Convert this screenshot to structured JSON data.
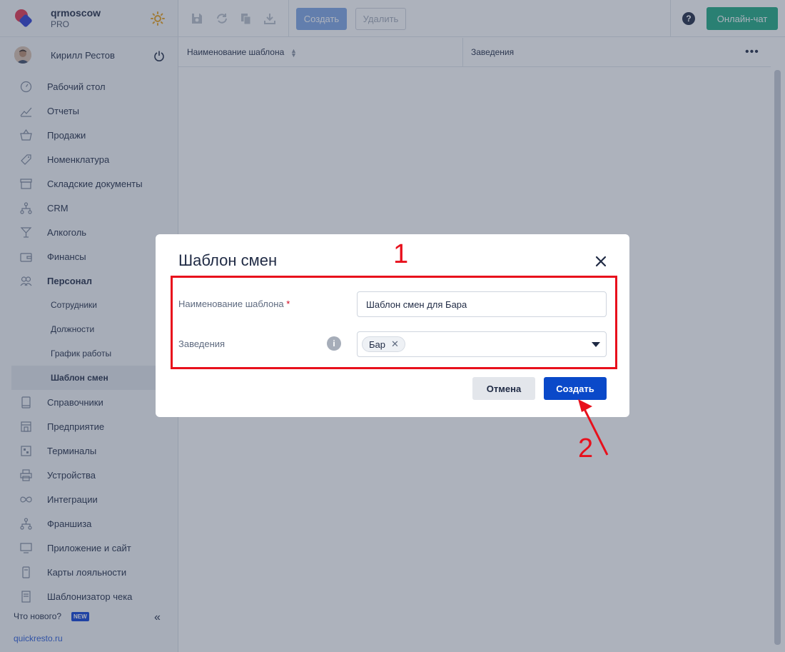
{
  "brand": {
    "name": "qrmoscow",
    "plan": "PRO"
  },
  "user": {
    "name": "Кирилл Рестов"
  },
  "nav": [
    {
      "label": "Рабочий стол",
      "icon": "dashboard-icon"
    },
    {
      "label": "Отчеты",
      "icon": "chart-icon"
    },
    {
      "label": "Продажи",
      "icon": "basket-icon"
    },
    {
      "label": "Номенклатура",
      "icon": "tag-icon"
    },
    {
      "label": "Складские документы",
      "icon": "archive-icon"
    },
    {
      "label": "CRM",
      "icon": "hierarchy-icon"
    },
    {
      "label": "Алкоголь",
      "icon": "glass-icon"
    },
    {
      "label": "Финансы",
      "icon": "wallet-icon"
    },
    {
      "label": "Персонал",
      "icon": "people-icon"
    },
    {
      "label": "Сотрудники"
    },
    {
      "label": "Должности"
    },
    {
      "label": "График работы"
    },
    {
      "label": "Шаблон смен"
    },
    {
      "label": "Справочники",
      "icon": "book-icon"
    },
    {
      "label": "Предприятие",
      "icon": "store-icon"
    },
    {
      "label": "Терминалы",
      "icon": "qr-icon"
    },
    {
      "label": "Устройства",
      "icon": "printer-icon"
    },
    {
      "label": "Интеграции",
      "icon": "infinity-icon"
    },
    {
      "label": "Франшиза",
      "icon": "hierarchy-icon"
    },
    {
      "label": "Приложение и сайт",
      "icon": "monitor-icon"
    },
    {
      "label": "Карты лояльности",
      "icon": "card-icon"
    },
    {
      "label": "Шаблонизатор чека",
      "icon": "receipt-icon"
    }
  ],
  "footer": {
    "whats_new": "Что нового?",
    "badge": "NEW",
    "collapse": "«",
    "site": "quickresto.ru"
  },
  "toolbar": {
    "create_label": "Создать",
    "delete_label": "Удалить",
    "help": "?",
    "chat_label": "Онлайн-чат"
  },
  "table": {
    "col1": "Наименование шаблона",
    "col2": "Заведения",
    "more": "•••"
  },
  "modal": {
    "title": "Шаблон смен",
    "close": "✕",
    "name_label": "Наименование шаблона",
    "required_mark": "*",
    "name_value": "Шаблон смен для Бара",
    "venues_label": "Заведения",
    "info": "i",
    "venue_chip": "Бар",
    "chip_remove": "✕",
    "cancel_label": "Отмена",
    "create_label": "Создать"
  },
  "annotations": {
    "one": "1",
    "two": "2"
  },
  "colors": {
    "primary": "#0a49c9",
    "chat": "#1ea982",
    "annotation": "#e8101c"
  }
}
